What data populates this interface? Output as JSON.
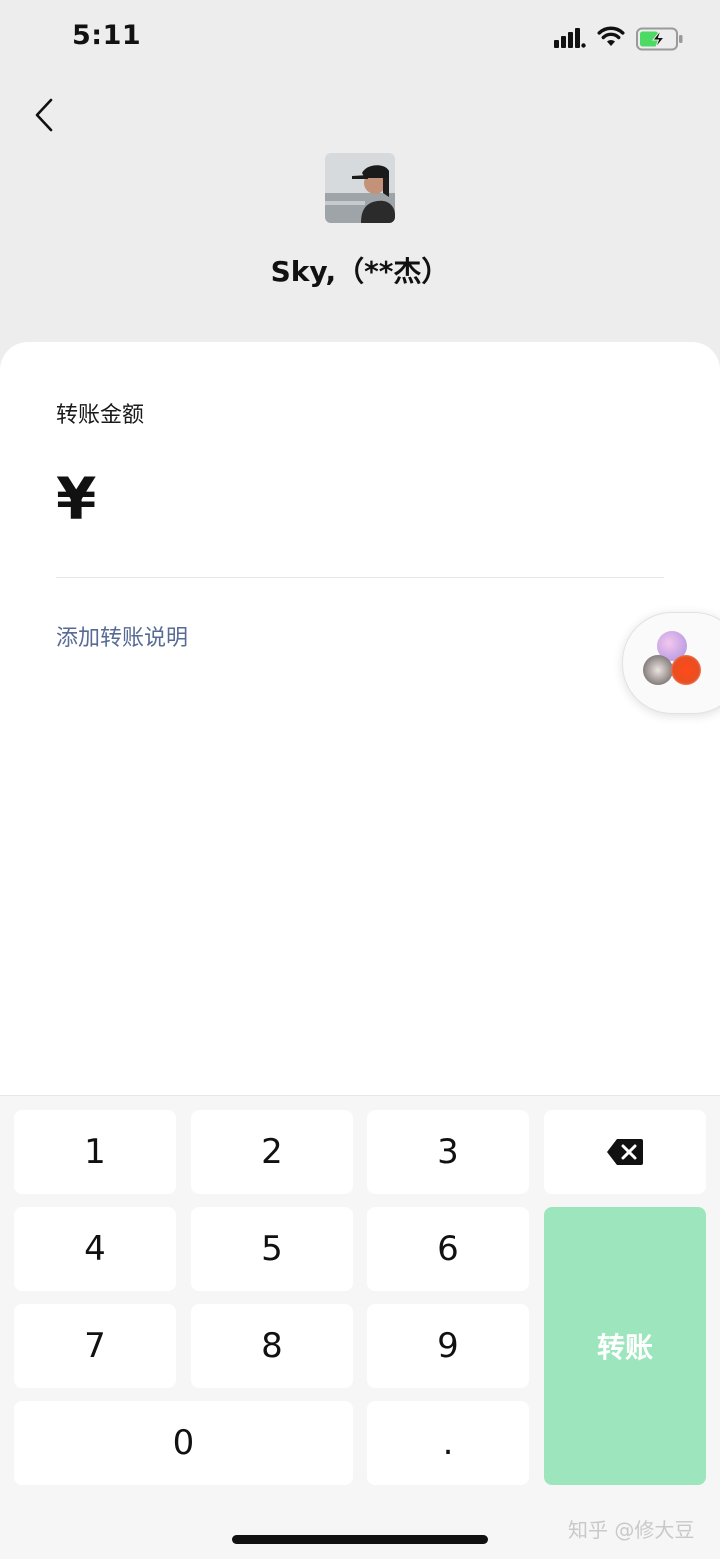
{
  "status_bar": {
    "time": "5:11"
  },
  "recipient": {
    "name": "Sky,（**杰）"
  },
  "transfer": {
    "amount_label": "转账金额",
    "currency_symbol": "¥",
    "amount_value": "",
    "add_note_label": "添加转账说明"
  },
  "keypad": {
    "keys": [
      "1",
      "2",
      "3",
      "4",
      "5",
      "6",
      "7",
      "8",
      "9",
      "0",
      "."
    ],
    "confirm_label": "转账"
  },
  "watermark": {
    "text": "知乎 @修大豆"
  },
  "colors": {
    "accent": "#9de6bd",
    "link": "#576b95",
    "battery": "#4cd964"
  }
}
